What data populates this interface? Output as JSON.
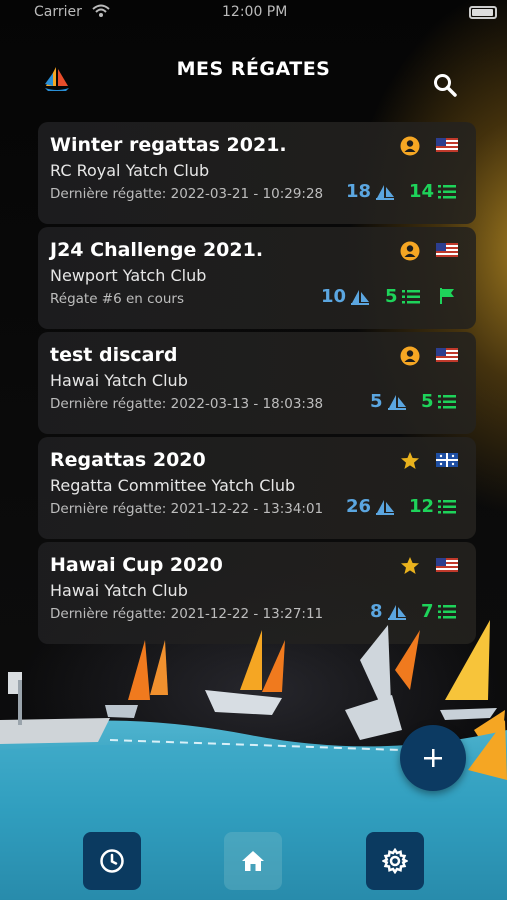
{
  "status_bar": {
    "carrier": "Carrier",
    "time": "12:00 PM"
  },
  "header": {
    "title": "MES RÉGATES",
    "logo_icon": "sailboat-logo-icon",
    "search_icon": "search-icon"
  },
  "regattas": [
    {
      "title": "Winter regattas 2021.",
      "club": "RC Royal Yatch Club",
      "info": "Dernière régatte: 2022-03-21 - 10:29:28",
      "boats": "18",
      "races": "14",
      "role_icon": "user-icon",
      "flag": "us-flag"
    },
    {
      "title": "J24 Challenge 2021.",
      "club": "Newport Yatch Club",
      "info": "Régate #6 en cours",
      "boats": "10",
      "races": "5",
      "role_icon": "user-icon",
      "flag": "us-flag",
      "status_icon": "race-flag-icon"
    },
    {
      "title": "test discard",
      "club": "Hawai Yatch Club",
      "info": "Dernière régatte: 2022-03-13 - 18:03:38",
      "boats": "5",
      "races": "5",
      "role_icon": "user-icon",
      "flag": "us-flag"
    },
    {
      "title": "Regattas 2020",
      "club": "Regatta Committee Yatch Club",
      "info": "Dernière régatte: 2021-12-22 - 13:34:01",
      "boats": "26",
      "races": "12",
      "role_icon": "star-icon",
      "flag": "quebec-flag"
    },
    {
      "title": "Hawai Cup 2020",
      "club": "Hawai Yatch Club",
      "info": "Dernière régatte: 2021-12-22 - 13:27:11",
      "boats": "8",
      "races": "7",
      "role_icon": "star-icon",
      "flag": "us-flag"
    }
  ],
  "colors": {
    "accent_orange": "#f5a623",
    "boats_blue": "#5ba6e0",
    "races_green": "#1ed35a",
    "nav_dark": "#0b3a60"
  },
  "nav": {
    "items": [
      "clock-icon",
      "home-icon",
      "gear-icon"
    ],
    "fab_icon": "plus-icon"
  }
}
